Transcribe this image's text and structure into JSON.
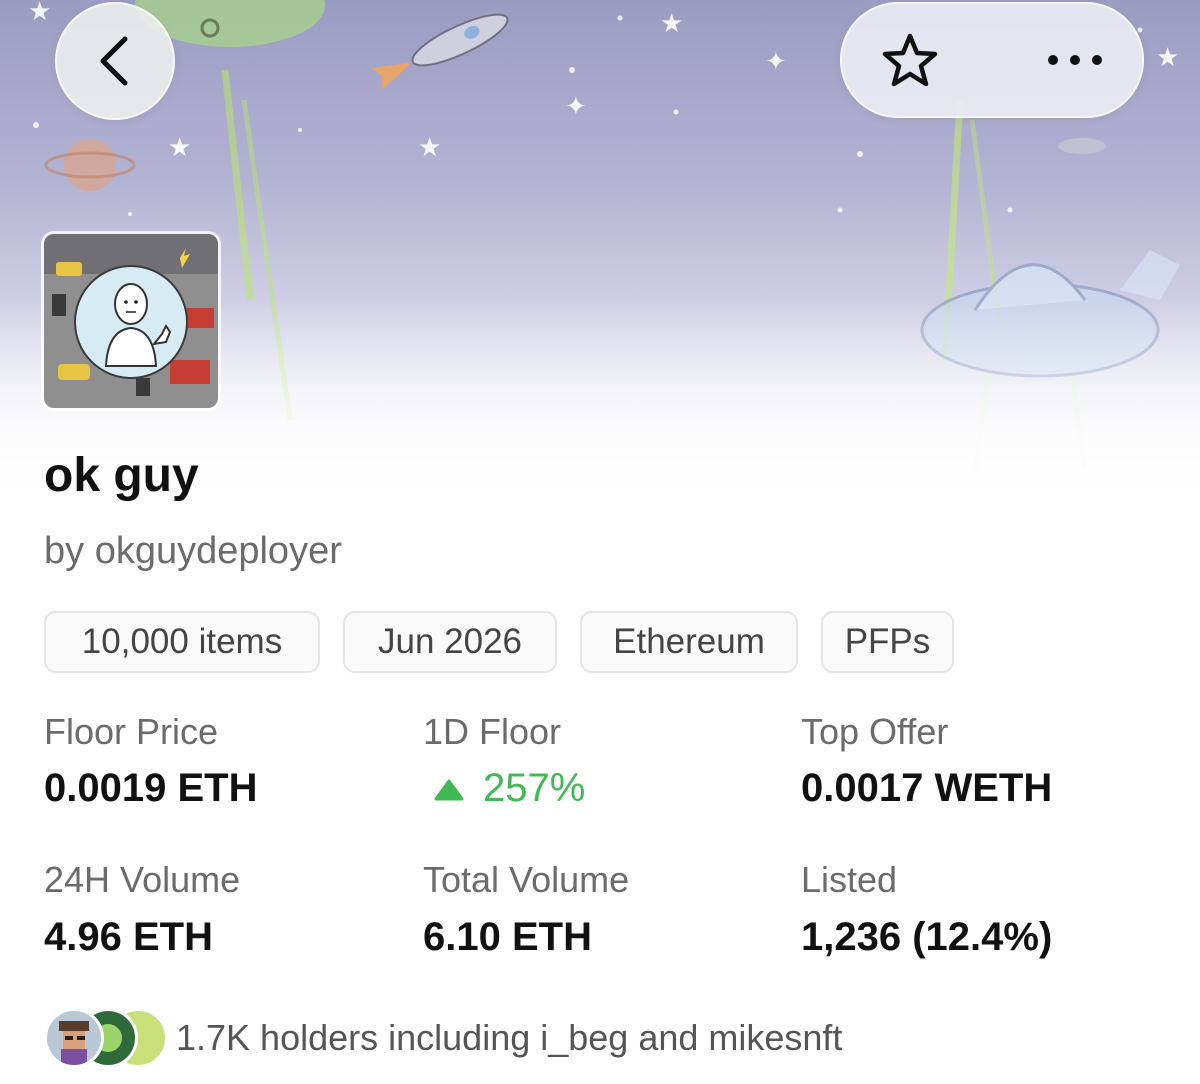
{
  "header": {
    "back_icon": "chevron-left-icon",
    "favorite_icon": "star-outline-icon",
    "more_icon": "more-horizontal-icon"
  },
  "collection": {
    "name": "ok guy",
    "creator": "by okguydeployer",
    "tags": [
      "10,000 items",
      "Jun 2026",
      "Ethereum",
      "PFPs"
    ]
  },
  "stats": [
    {
      "label": "Floor Price",
      "value": "0.0019 ETH"
    },
    {
      "label": "1D Floor",
      "value": "257%",
      "trend": "up",
      "trend_color": "#3fb954"
    },
    {
      "label": "Top Offer",
      "value": "0.0017 WETH"
    },
    {
      "label": "24H Volume",
      "value": "4.96 ETH"
    },
    {
      "label": "Total Volume",
      "value": "6.10 ETH"
    },
    {
      "label": "Listed",
      "value": "1,236 (12.4%)"
    }
  ],
  "holders": {
    "text": "1.7K holders including i_beg and mikesnft"
  },
  "colors": {
    "accent_green": "#3fb954",
    "text_primary": "#111111",
    "text_secondary": "#6b6b6b"
  }
}
